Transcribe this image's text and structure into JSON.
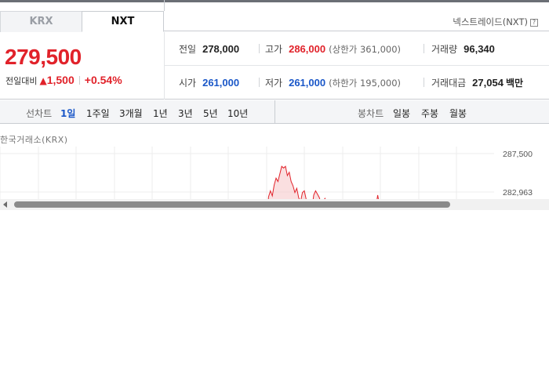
{
  "tabs": [
    {
      "label": "KRX",
      "active": false
    },
    {
      "label": "NXT",
      "active": true
    }
  ],
  "nxt_link": {
    "label": "넥스트레이드(NXT)",
    "help_glyph": "?"
  },
  "price": {
    "current": "279,500",
    "change_label": "전일대비",
    "change_amount": "1,500",
    "change_direction": "up",
    "change_percent": "+0.54%"
  },
  "stats": {
    "prev_close": {
      "label": "전일",
      "value": "278,000"
    },
    "high": {
      "label": "고가",
      "value": "286,000",
      "sub": "(상한가 361,000)"
    },
    "volume": {
      "label": "거래량",
      "value": "96,340"
    },
    "open": {
      "label": "시가",
      "value": "261,000"
    },
    "low": {
      "label": "저가",
      "value": "261,000",
      "sub": "(하한가 195,000)"
    },
    "trade_value": {
      "label": "거래대금",
      "value": "27,054",
      "unit": "백만"
    }
  },
  "period_bar": {
    "line_label": "선차트",
    "line_items": [
      "1일",
      "1주일",
      "3개월",
      "1년",
      "3년",
      "5년",
      "10년"
    ],
    "active_item": "1일",
    "candle_label": "봉차트",
    "candle_items": [
      "일봉",
      "주봉",
      "월봉"
    ]
  },
  "colors": {
    "up": "#e1222a",
    "down": "#1a57c8",
    "active": "#1a57c8"
  },
  "chart_data": {
    "type": "line",
    "title": "한국거래소(KRX)",
    "y_ticks": [
      "287,500",
      "282,963"
    ],
    "ylim": [
      278000,
      288000
    ],
    "grid": true,
    "series": [
      {
        "values": [
          279000,
          282400,
          283100,
          282500,
          283800,
          284600,
          284200,
          285100,
          286000,
          285800,
          286000,
          284900,
          285300,
          284200,
          283700,
          282900,
          283400,
          282300,
          281800,
          282900,
          283100,
          282100,
          281200,
          281800,
          280900,
          282600,
          283100,
          282700,
          282300,
          281500,
          281900,
          282200,
          281100,
          281700,
          281300,
          281700,
          281200,
          281100,
          281500,
          281300,
          280800,
          281200,
          281000,
          280900,
          281300,
          281100,
          281400,
          281200,
          280900,
          281100,
          281200,
          281000,
          281300,
          280800,
          281100,
          281000,
          281400,
          281000,
          281200,
          282600,
          281300,
          281100,
          281000,
          280900,
          281200,
          281000,
          280800,
          281100,
          280900,
          281000,
          280900,
          281200,
          281000,
          280800,
          281100,
          281000
        ]
      }
    ]
  }
}
